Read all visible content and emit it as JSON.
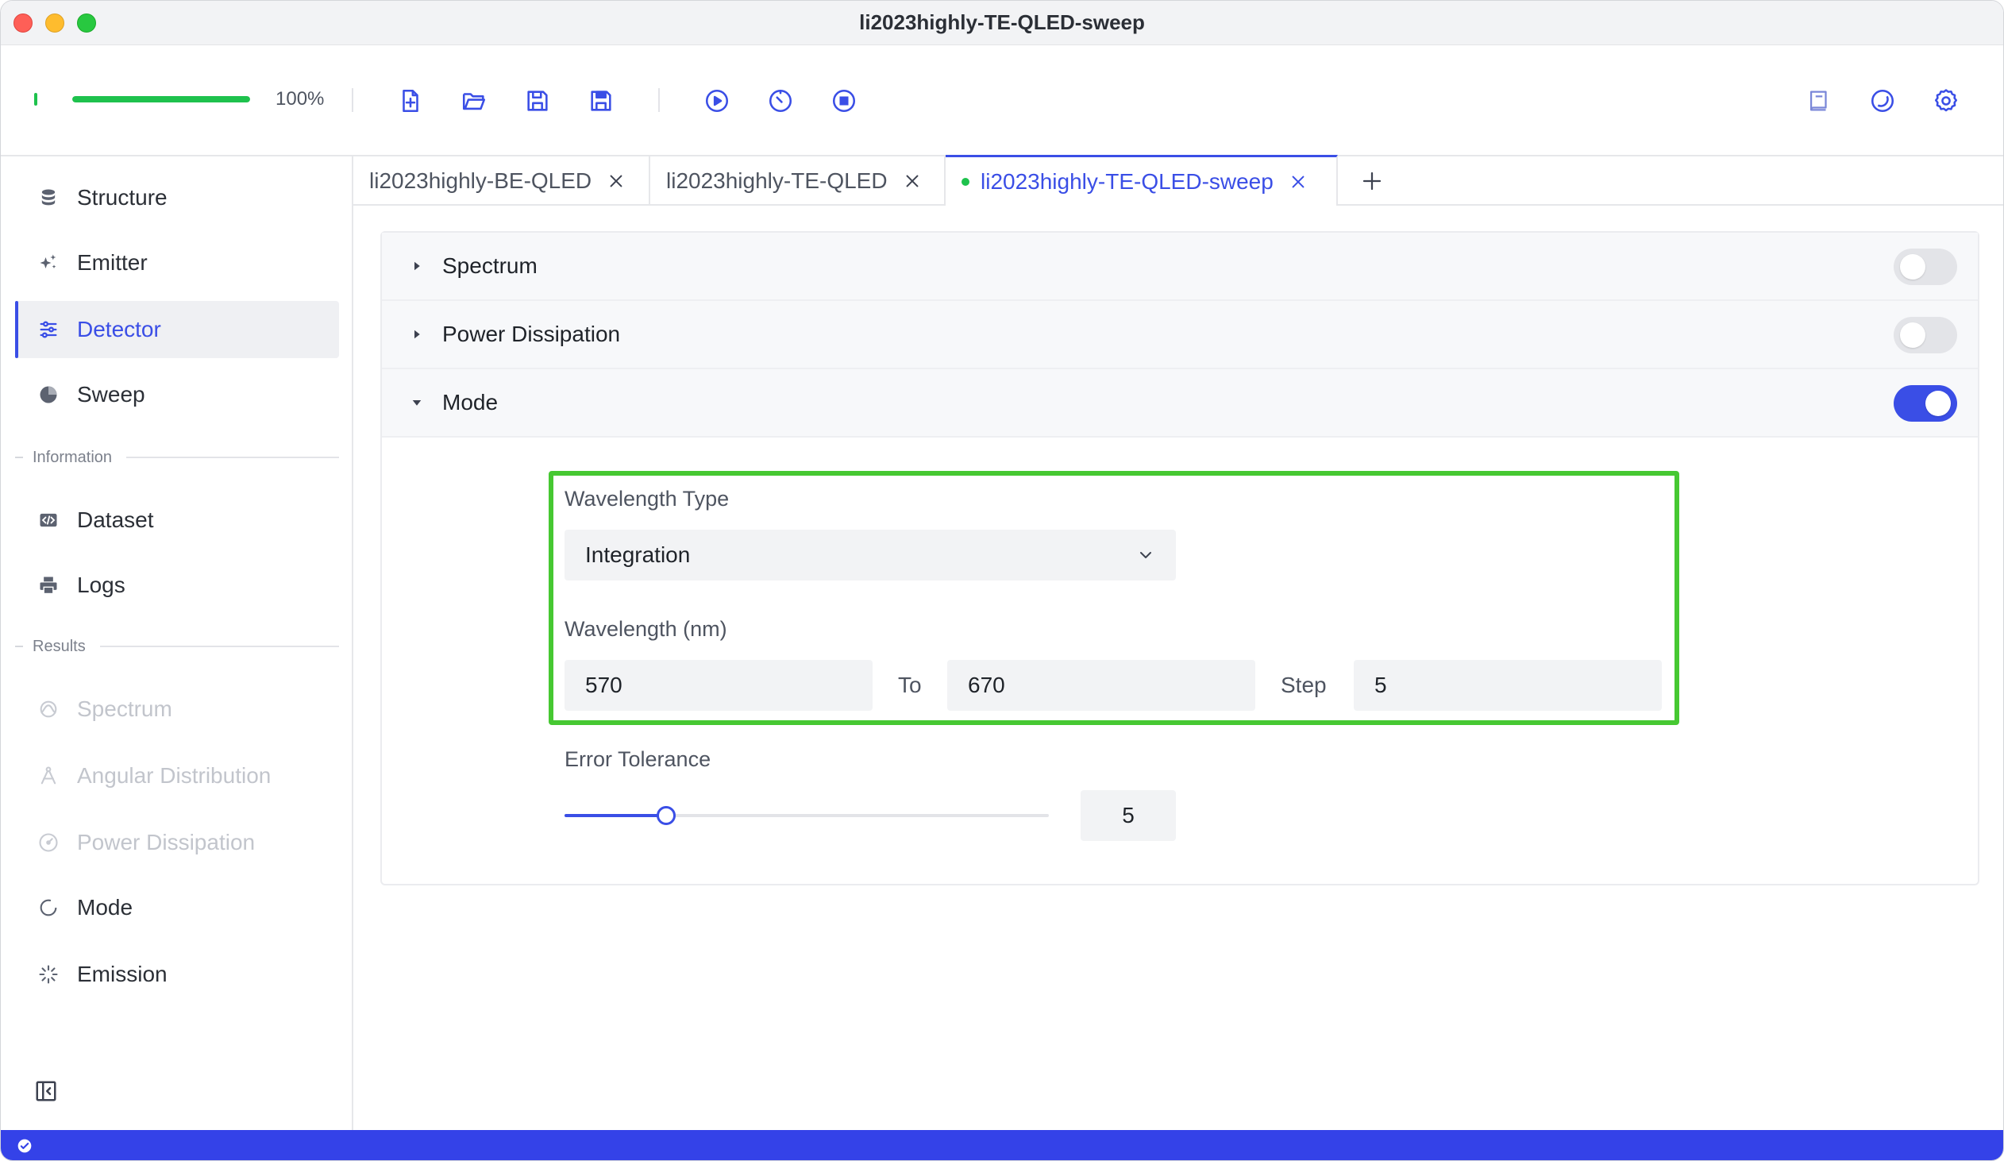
{
  "window": {
    "title": "li2023highly-TE-QLED-sweep"
  },
  "toolbar": {
    "progress_fraction": 1.0,
    "progress_text": "100%",
    "buttons": [
      "new-file-icon",
      "open-folder-icon",
      "save-icon",
      "save-as-icon",
      "run-icon",
      "timer-run-icon",
      "stop-icon"
    ],
    "right_buttons": [
      "book-icon",
      "theme-icon",
      "gear-icon"
    ]
  },
  "sidebar": {
    "items": [
      {
        "label": "Structure",
        "icon": "database-icon"
      },
      {
        "label": "Emitter",
        "icon": "sparkle-icon"
      },
      {
        "label": "Detector",
        "icon": "sliders-icon",
        "active": true
      },
      {
        "label": "Sweep",
        "icon": "pie-icon"
      }
    ],
    "information_header": "Information",
    "information_items": [
      {
        "label": "Dataset",
        "icon": "code-icon"
      },
      {
        "label": "Logs",
        "icon": "printer-icon"
      }
    ],
    "results_header": "Results",
    "results_items": [
      {
        "label": "Spectrum",
        "icon": "spectrum-icon",
        "disabled": true
      },
      {
        "label": "Angular Distribution",
        "icon": "angle-icon",
        "disabled": true
      },
      {
        "label": "Power Dissipation",
        "icon": "gauge-icon",
        "disabled": true
      },
      {
        "label": "Mode",
        "icon": "circle-icon"
      },
      {
        "label": "Emission",
        "icon": "burst-icon"
      }
    ]
  },
  "tabs": [
    {
      "label": "li2023highly-BE-QLED"
    },
    {
      "label": "li2023highly-TE-QLED"
    },
    {
      "label": "li2023highly-TE-QLED-sweep",
      "active": true,
      "modified": true
    }
  ],
  "sections": {
    "spectrum": {
      "label": "Spectrum",
      "enabled": false,
      "expanded": false
    },
    "power_dissipation": {
      "label": "Power Dissipation",
      "enabled": false,
      "expanded": false
    },
    "mode": {
      "label": "Mode",
      "enabled": true,
      "expanded": true
    }
  },
  "mode_form": {
    "wavelength_type_label": "Wavelength Type",
    "wavelength_type_value": "Integration",
    "wavelength_label": "Wavelength (nm)",
    "wavelength_from": "570",
    "to_label": "To",
    "wavelength_to": "670",
    "step_label": "Step",
    "step_value": "5",
    "error_tolerance_label": "Error Tolerance",
    "error_tolerance_value": "5",
    "error_tolerance_fraction": 0.21
  },
  "colors": {
    "accent": "#3a4ee6",
    "success": "#1ec24d",
    "highlight": "#46c832",
    "statusbar": "#3442e8"
  }
}
